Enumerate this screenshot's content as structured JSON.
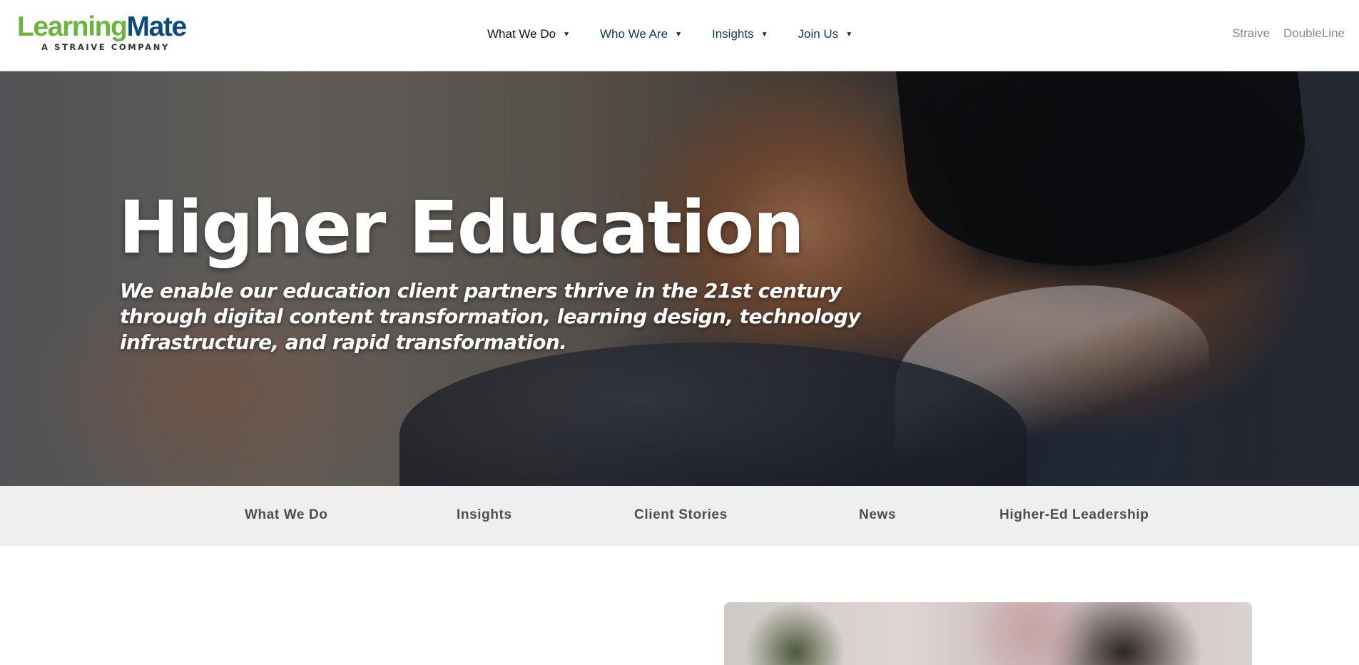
{
  "logo": {
    "brand_part1": "Learning",
    "brand_part2": "Mate",
    "tagline": "A STRAIVE COMPANY",
    "colors": {
      "learning": "#6cb33f",
      "mate": "#0c4a7a"
    }
  },
  "main_nav": {
    "items": [
      {
        "label": "What We Do"
      },
      {
        "label": "Who We Are"
      },
      {
        "label": "Insights"
      },
      {
        "label": "Join Us"
      }
    ],
    "caret": "▼"
  },
  "side_links": [
    "Straive",
    "DoubleLine"
  ],
  "hero": {
    "title": "Higher Education",
    "subtitle": "We enable our education client partners thrive in the 21st century through digital content transformation, learning design, technology infrastructure, and rapid transformation."
  },
  "sub_nav": [
    "What We Do",
    "Insights",
    "Client Stories",
    "News",
    "Higher-Ed Leadership"
  ],
  "colors": {
    "nav_text": "#0e3a5c",
    "subnav_bg": "#efefef",
    "subnav_text": "#4d4d4d"
  }
}
